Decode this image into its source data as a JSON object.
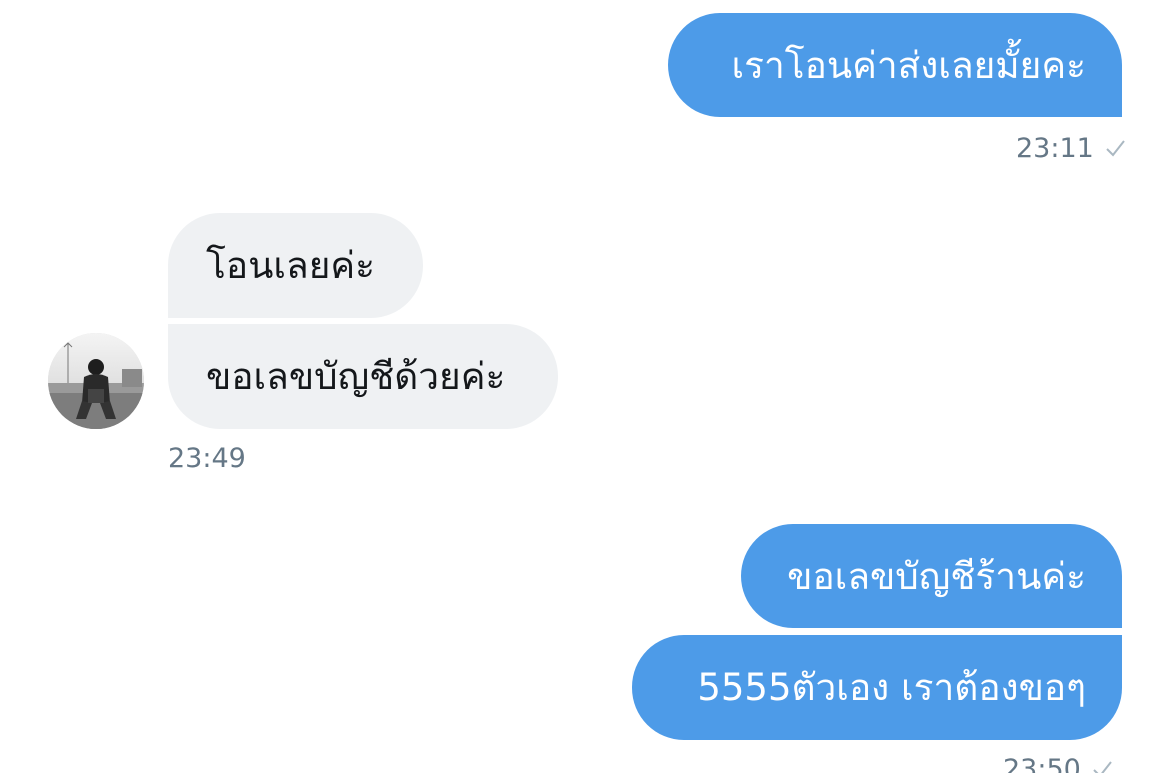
{
  "conversation": {
    "messages": [
      {
        "id": "m1",
        "direction": "outgoing",
        "text": "เราโอนค่าส่งเลยมั้ยคะ"
      },
      {
        "id": "m2",
        "direction": "incoming",
        "text": "โอนเลยค่ะ"
      },
      {
        "id": "m3",
        "direction": "incoming",
        "text": "ขอเลขบัญชีด้วยค่ะ"
      },
      {
        "id": "m4",
        "direction": "outgoing",
        "text": "ขอเลขบัญชีร้านค่ะ"
      },
      {
        "id": "m5",
        "direction": "outgoing",
        "text": "5555ตัวเอง เราต้องขอๆ"
      }
    ],
    "timestamps": {
      "t1": "23:11",
      "t2": "23:49",
      "t3": "23:50"
    }
  },
  "colors": {
    "outgoing_bubble": "#4d9be8",
    "incoming_bubble": "#eff1f3",
    "timestamp": "#657786"
  },
  "icons": {
    "read_receipt": "checkmark-icon",
    "avatar": "contact-avatar"
  }
}
